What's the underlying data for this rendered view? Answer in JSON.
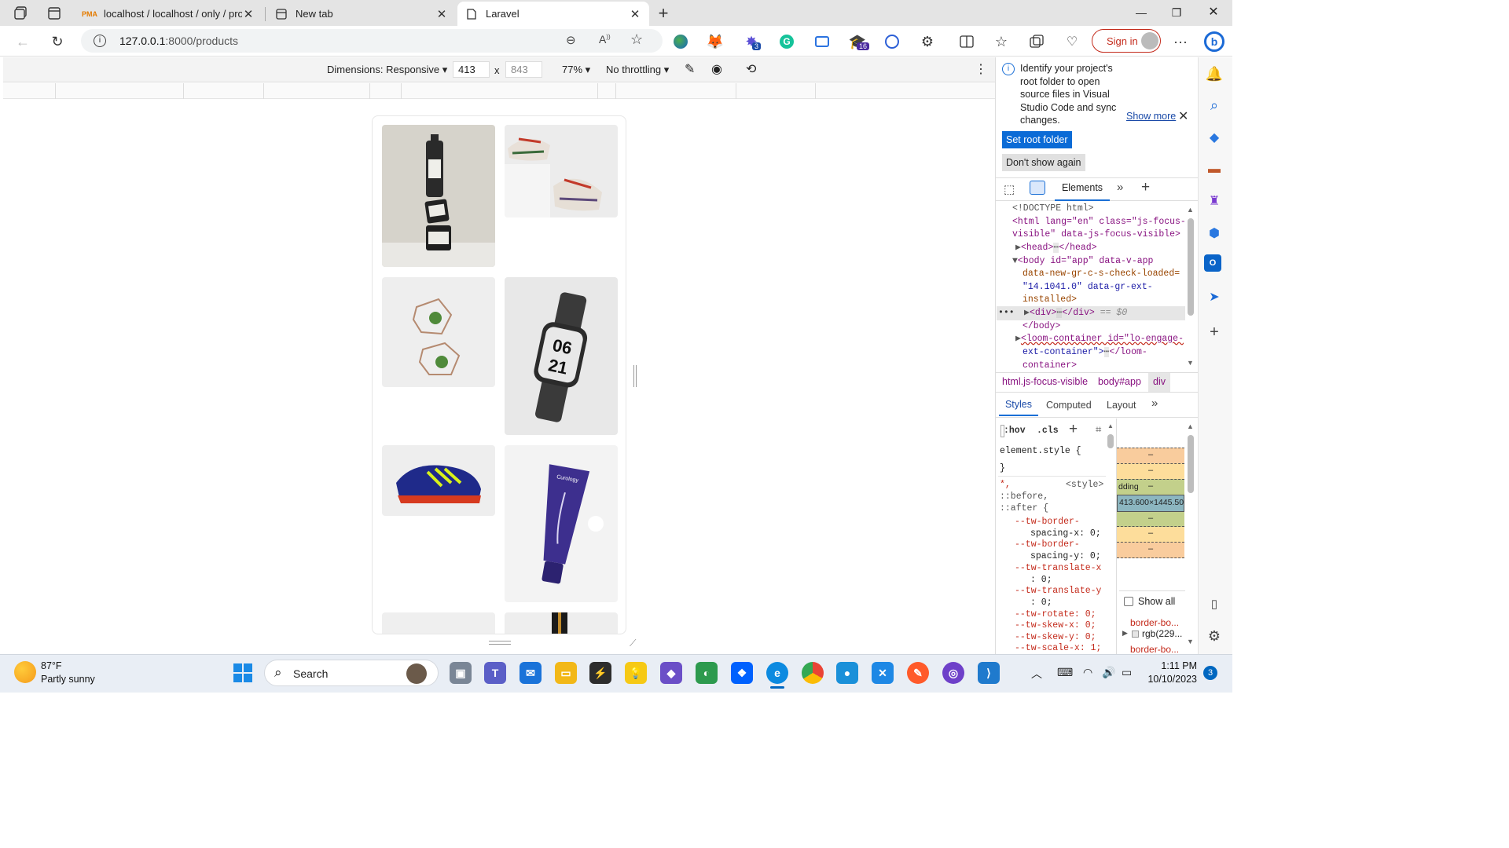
{
  "tabs": [
    {
      "icon": "pma-icon",
      "title": "localhost / localhost / only / products"
    },
    {
      "icon": "newtab-icon",
      "title": "New tab"
    },
    {
      "icon": "page-icon",
      "title": "Laravel"
    }
  ],
  "address": {
    "url_host": "127.0.0.1",
    "url_rest": ":8000/products"
  },
  "toolbar": {
    "signin_label": "Sign in",
    "extension_badges": [
      "3",
      "16"
    ]
  },
  "device_toolbar": {
    "dimensions_label": "Dimensions: Responsive",
    "width": "413",
    "times": "x",
    "height": "843",
    "zoom": "77%",
    "throttling": "No throttling"
  },
  "products": [
    {
      "name": "bottle-stack",
      "bg": "#d6d3cb"
    },
    {
      "name": "sneakers",
      "bg": "#ececec"
    },
    {
      "name": "wire-planters",
      "bg": "#eeeeee"
    },
    {
      "name": "smartwatch",
      "bg": "#e8e8e8"
    },
    {
      "name": "blue-sneaker",
      "bg": "#eeeeee"
    },
    {
      "name": "purple-tube",
      "bg": "#f3f3f3"
    }
  ],
  "watch_face": {
    "line1": "06",
    "line2": "21"
  },
  "tube_label": "Curology",
  "notice": {
    "text": "Identify your project's root folder to open source files in Visual Studio Code and sync changes.",
    "show_more": "Show more",
    "set_root": "Set root folder",
    "dont_show": "Don't show again"
  },
  "devtools_tabs": {
    "elements": "Elements"
  },
  "dom": {
    "doctype": "<!DOCTYPE html>",
    "html_open_1": "<html lang=\"en\" class=\"js-focus-",
    "html_open_2": "visible\" data-js-focus-visible>",
    "head": "<head>",
    "head_close": "</head>",
    "body_1": "<body id=\"app\" data-v-app",
    "body_2": "data-new-gr-c-s-check-loaded=",
    "body_3": "\"14.1041.0\" data-gr-ext-",
    "body_4": "installed>",
    "div": "<div>",
    "div_close": "</div>",
    "eq": "== $0",
    "body_close": "</body>",
    "loom_1": "<loom-container id=\"lo-engage-",
    "loom_2": "ext-container\">",
    "loom_3": "</loom-",
    "loom_4": "container>"
  },
  "breadcrumb": [
    "html.js-focus-visible",
    "body#app",
    "div"
  ],
  "styles_tabs": [
    "Styles",
    "Computed",
    "Layout"
  ],
  "filter": {
    "hov": ":hov",
    "cls": ".cls"
  },
  "styles": {
    "element_style": "element.style {",
    "close_brace": "}",
    "selector_1": "*,",
    "source": "<style>",
    "selector_2": "::before,",
    "selector_3": "::after {",
    "props": [
      "--tw-border-",
      "spacing-x: 0;",
      "--tw-border-",
      "spacing-y: 0;",
      "--tw-translate-x",
      ": 0;",
      "--tw-translate-y",
      ": 0;",
      "--tw-rotate: 0;",
      "--tw-skew-x: 0;",
      "--tw-skew-y: 0;",
      "--tw-scale-x: 1;"
    ]
  },
  "boxmodel": {
    "padding_label": "dding",
    "dash": "–",
    "size": "413.600×1445.500"
  },
  "computed": {
    "show_all": "Show all",
    "prop": "border-bo...",
    "value": "rgb(229...",
    "prop2": "border-bo..."
  },
  "taskbar": {
    "temp": "87°F",
    "weather": "Partly sunny",
    "search": "Search",
    "time": "1:11 PM",
    "date": "10/10/2023",
    "notif": "3"
  },
  "colors": {
    "accent": "#0067c0",
    "signin": "#c42b1c",
    "tag": "#881280",
    "attr": "#994500",
    "value": "#1a1aa6"
  }
}
